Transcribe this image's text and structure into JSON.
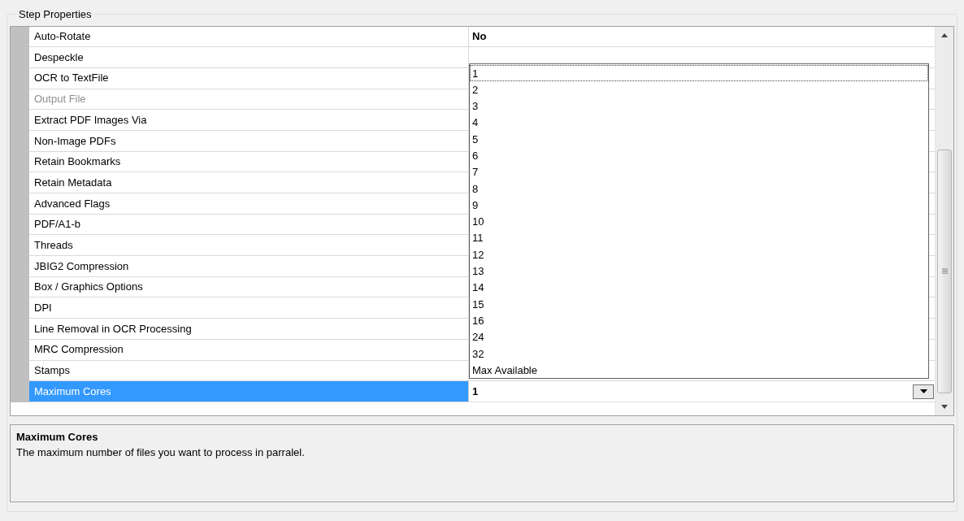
{
  "group_title": "Step Properties",
  "properties": [
    {
      "name": "Auto-Rotate",
      "value": "No",
      "disabled": false,
      "selected": false
    },
    {
      "name": "Despeckle",
      "disabled": false,
      "selected": false
    },
    {
      "name": "OCR to TextFile",
      "disabled": false,
      "selected": false
    },
    {
      "name": "Output File",
      "disabled": true,
      "selected": false
    },
    {
      "name": "Extract PDF Images Via",
      "disabled": false,
      "selected": false
    },
    {
      "name": "Non-Image PDFs",
      "disabled": false,
      "selected": false
    },
    {
      "name": "Retain Bookmarks",
      "disabled": false,
      "selected": false
    },
    {
      "name": "Retain Metadata",
      "disabled": false,
      "selected": false
    },
    {
      "name": "Advanced Flags",
      "disabled": false,
      "selected": false
    },
    {
      "name": "PDF/A1-b",
      "disabled": false,
      "selected": false
    },
    {
      "name": "Threads",
      "disabled": false,
      "selected": false
    },
    {
      "name": "JBIG2 Compression",
      "disabled": false,
      "selected": false
    },
    {
      "name": "Box / Graphics Options",
      "disabled": false,
      "selected": false
    },
    {
      "name": "DPI",
      "disabled": false,
      "selected": false
    },
    {
      "name": "Line Removal in OCR Processing",
      "disabled": false,
      "selected": false
    },
    {
      "name": "MRC Compression",
      "disabled": false,
      "selected": false
    },
    {
      "name": "Stamps",
      "disabled": false,
      "selected": false
    },
    {
      "name": "Maximum Cores",
      "value": "1",
      "disabled": false,
      "selected": true
    }
  ],
  "dropdown_options": [
    {
      "label": "1",
      "selected": true
    },
    {
      "label": "2",
      "selected": false
    },
    {
      "label": "3",
      "selected": false
    },
    {
      "label": "4",
      "selected": false
    },
    {
      "label": "5",
      "selected": false
    },
    {
      "label": "6",
      "selected": false
    },
    {
      "label": "7",
      "selected": false
    },
    {
      "label": "8",
      "selected": false
    },
    {
      "label": "9",
      "selected": false
    },
    {
      "label": "10",
      "selected": false
    },
    {
      "label": "11",
      "selected": false
    },
    {
      "label": "12",
      "selected": false
    },
    {
      "label": "13",
      "selected": false
    },
    {
      "label": "14",
      "selected": false
    },
    {
      "label": "15",
      "selected": false
    },
    {
      "label": "16",
      "selected": false
    },
    {
      "label": "24",
      "selected": false
    },
    {
      "label": "32",
      "selected": false
    },
    {
      "label": "Max Available",
      "selected": false
    }
  ],
  "description": {
    "title": "Maximum Cores",
    "text": "The maximum number of files you want to process in parralel."
  }
}
